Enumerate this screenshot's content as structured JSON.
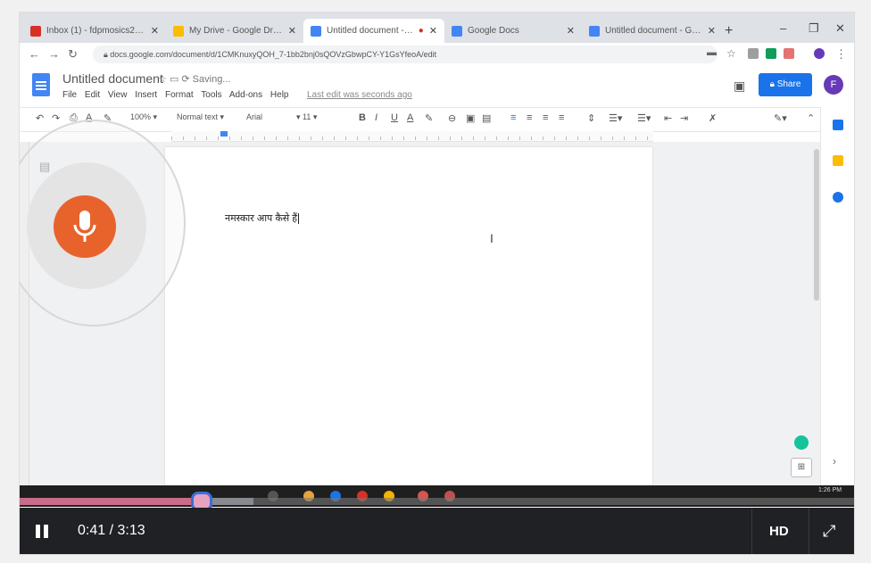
{
  "browser": {
    "tabs": [
      {
        "title": "Inbox (1) - fdpmosics2@gmail...",
        "color": "#d93025",
        "active": false
      },
      {
        "title": "My Drive - Google Drive",
        "color": "#fbbc04",
        "active": false
      },
      {
        "title": "Untitled document - Goo",
        "color": "#4285f4",
        "active": true
      },
      {
        "title": "Google Docs",
        "color": "#4285f4",
        "active": false
      },
      {
        "title": "Untitled document - Google D",
        "color": "#4285f4",
        "active": false
      }
    ],
    "url": "docs.google.com/document/d/1CMKnuxyQOH_7-1bb2bnj0sQOVzGbwpCY-Y1GsYfeoA/edit",
    "new_tab": "+",
    "minimize": "–",
    "restore": "❐",
    "close": "✕"
  },
  "docs": {
    "title": "Untitled document",
    "saving": "Saving...",
    "menus": [
      "File",
      "Edit",
      "View",
      "Insert",
      "Format",
      "Tools",
      "Add-ons",
      "Help"
    ],
    "last_edit": "Last edit was seconds ago",
    "share_label": "Share",
    "avatar_letter": "F"
  },
  "toolbar": {
    "zoom": "100%",
    "style": "Normal text",
    "font": "Arial",
    "size": "11"
  },
  "document": {
    "text": "नमस्कार आप कैसे हैं"
  },
  "player": {
    "time": "0:41 / 3:13",
    "hd_label": "HD",
    "progress_fraction": 0.218
  },
  "taskbar": {
    "clock": "1:26 PM"
  },
  "colors": {
    "mic": "#e8632c",
    "share": "#1a73e8",
    "played": "#c96b8a"
  }
}
